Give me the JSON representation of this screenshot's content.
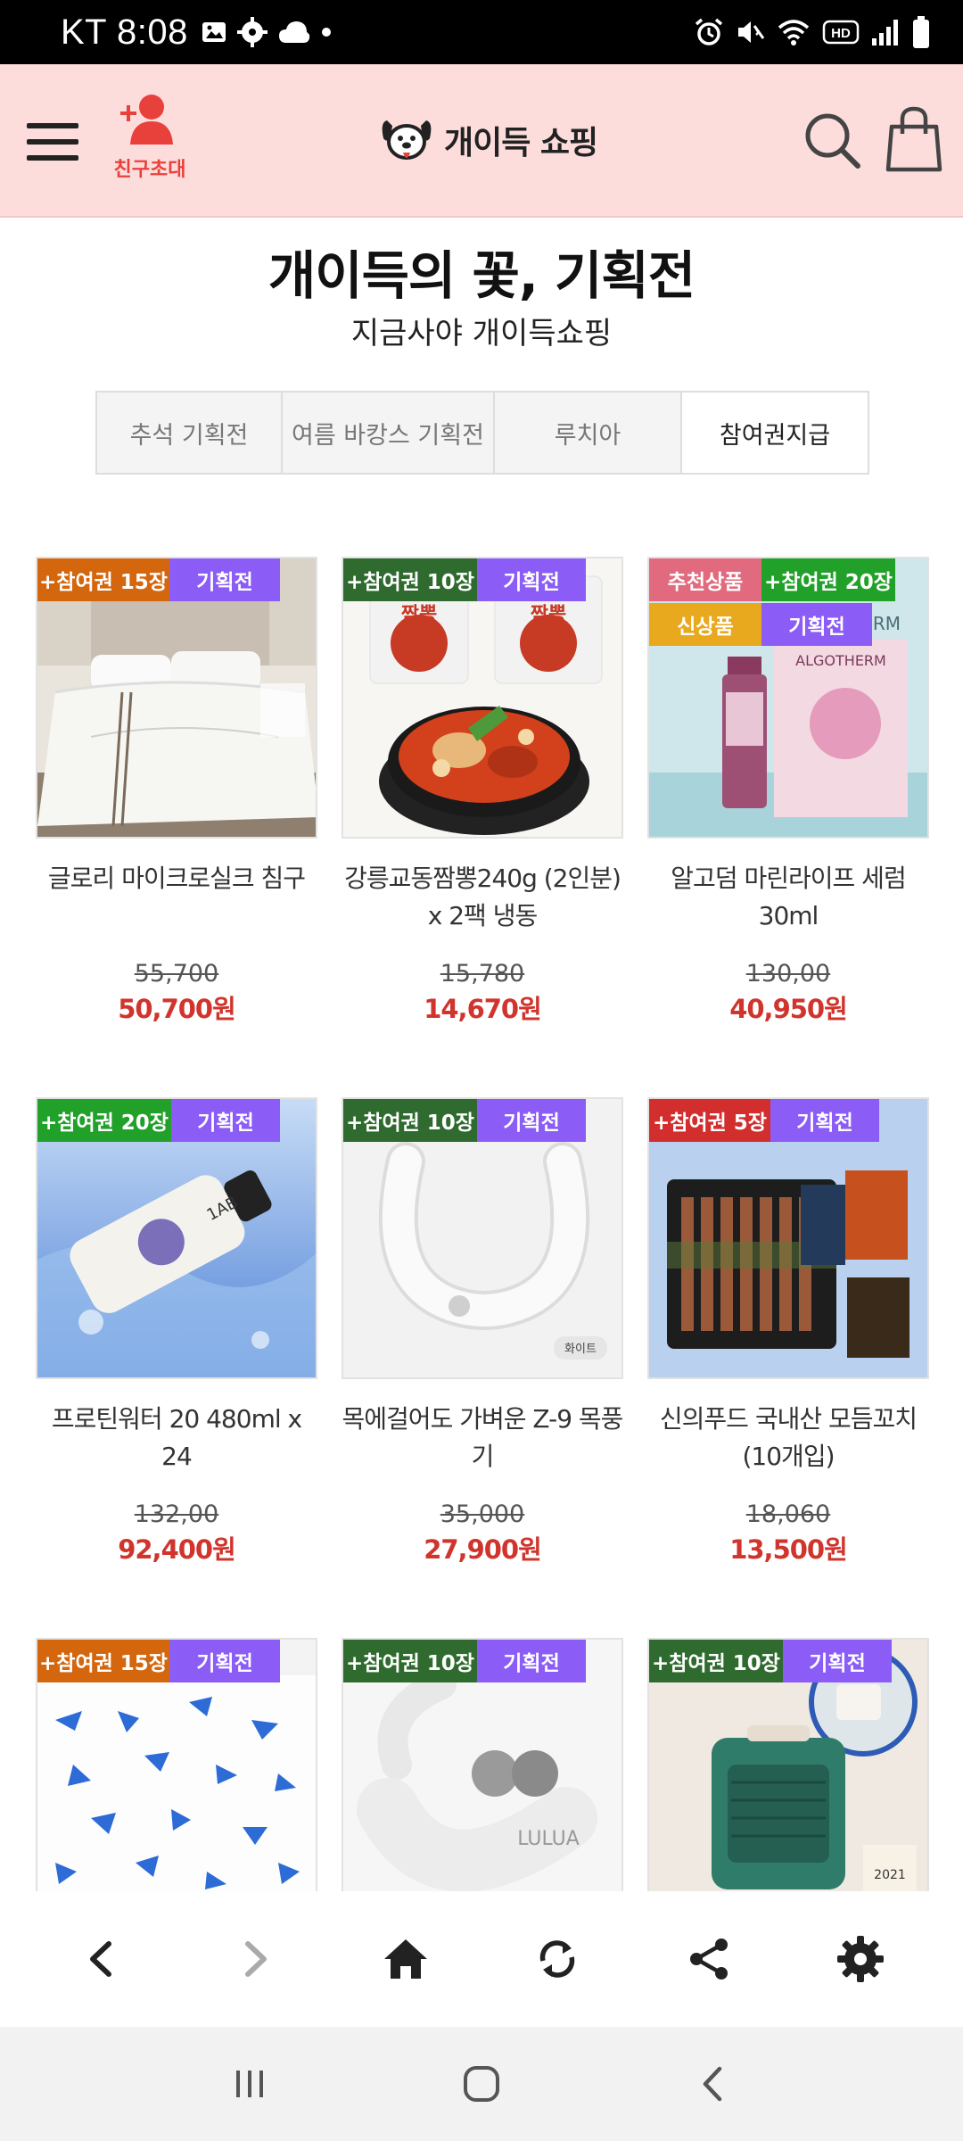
{
  "status": {
    "carrier_time": "KT 8:08",
    "network": "HD"
  },
  "header": {
    "invite_label": "친구초대",
    "logo_text": "개이득 쇼핑"
  },
  "page": {
    "title": "개이득의 꽃, 기획전",
    "subtitle": "지금사야 개이득쇼핑"
  },
  "tabs": [
    {
      "label": "추석 기획전"
    },
    {
      "label": "여름 바캉스 기획전"
    },
    {
      "label": "루치아"
    },
    {
      "label": "참여권지급",
      "active": true
    }
  ],
  "products": [
    {
      "name": "글로리 마이크로실크 침구",
      "original_price": "55,700",
      "price": "50,700원",
      "badges": [
        {
          "text": "+참여권 15장",
          "color": "#d4660e"
        },
        {
          "text": "기획전",
          "color": "#8b5cf6"
        }
      ]
    },
    {
      "name": "강릉교동짬뽕240g (2인분) x 2팩 냉동",
      "original_price": "15,780",
      "price": "14,670원",
      "badges": [
        {
          "text": "+참여권 10장",
          "color": "#2f6b2f"
        },
        {
          "text": "기획전",
          "color": "#8b5cf6"
        }
      ]
    },
    {
      "name": "알고덤 마린라이프 세럼 30ml",
      "original_price": "130,00",
      "price": "40,950원",
      "badges": [
        {
          "text": "추천상품",
          "color": "#e26a7e"
        },
        {
          "text": "+참여권 20장",
          "color": "#22a12a"
        }
      ],
      "badges2": [
        {
          "text": "신상품",
          "color": "#e8a91f"
        },
        {
          "text": "기획전",
          "color": "#8b5cf6"
        }
      ]
    },
    {
      "name": "프로틴워터 20 480ml x 24",
      "original_price": "132,00",
      "price": "92,400원",
      "badges": [
        {
          "text": "+참여권 20장",
          "color": "#22a12a"
        },
        {
          "text": "기획전",
          "color": "#8b5cf6"
        }
      ]
    },
    {
      "name": "목에걸어도 가벼운 Z-9 목풍기",
      "original_price": "35,000",
      "price": "27,900원",
      "badges": [
        {
          "text": "+참여권 10장",
          "color": "#2f6b2f"
        },
        {
          "text": "기획전",
          "color": "#8b5cf6"
        }
      ]
    },
    {
      "name": "신의푸드 국내산 모듬꼬치 (10개입)",
      "original_price": "18,060",
      "price": "13,500원",
      "badges": [
        {
          "text": "+참여권 5장",
          "color": "#d22e2e"
        },
        {
          "text": "기획전",
          "color": "#8b5cf6"
        }
      ]
    },
    {
      "name": "",
      "original_price": "",
      "price": "",
      "badges": [
        {
          "text": "+참여권 15장",
          "color": "#d4660e"
        },
        {
          "text": "기획전",
          "color": "#8b5cf6"
        }
      ]
    },
    {
      "name": "",
      "original_price": "",
      "price": "",
      "badges": [
        {
          "text": "+참여권 10장",
          "color": "#2f6b2f"
        },
        {
          "text": "기획전",
          "color": "#8b5cf6"
        }
      ]
    },
    {
      "name": "",
      "original_price": "",
      "price": "",
      "badges": [
        {
          "text": "+참여권 10장",
          "color": "#2f6b2f"
        },
        {
          "text": "기획전",
          "color": "#8b5cf6"
        }
      ]
    }
  ],
  "image_text": {
    "bottle_label": "1AB",
    "fan_label": "화이트",
    "cosmetic_brand": "ALGOTHERM",
    "massager_brand": "LULUA",
    "calendar_year": "2021"
  },
  "colors": {
    "header_bg": "#fddcdc",
    "price_red": "#d0342c",
    "purple_badge": "#8b5cf6"
  },
  "icons": {
    "menu": "hamburger-icon",
    "invite": "add-user-icon",
    "search": "search-icon",
    "cart": "shopping-bag-icon",
    "back": "chevron-left-icon",
    "forward": "chevron-right-icon",
    "home": "home-icon",
    "refresh": "refresh-icon",
    "share": "share-icon",
    "settings": "gear-icon"
  }
}
